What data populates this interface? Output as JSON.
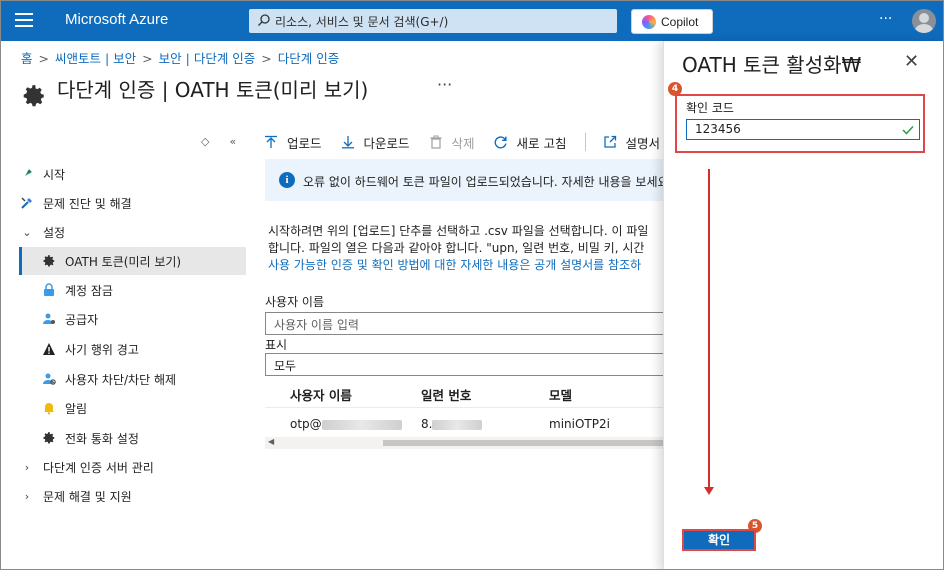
{
  "topbar": {
    "brand": "Microsoft Azure",
    "search_placeholder": "리소스, 서비스 및 문서 검색(G+/)",
    "copilot_label": "Copilot",
    "more": "···"
  },
  "breadcrumb": [
    "홈",
    "씨앤토트 | 보안",
    "보안 | 다단계 인증",
    "다단계 인증"
  ],
  "page": {
    "title": "다단계 인증 | OATH 토큰(미리 보기)",
    "more": "···"
  },
  "nav": {
    "tools": {
      "expand": "◇",
      "collapse": "«"
    },
    "items": [
      {
        "label": "시작",
        "icon": "rocket-icon"
      },
      {
        "label": "문제 진단 및 해결",
        "icon": "wrench-icon"
      },
      {
        "label": "설정",
        "icon": "chevron-down-icon"
      },
      {
        "label": "OATH 토큰(미리 보기)",
        "icon": "gear-icon"
      },
      {
        "label": "계정 잠금",
        "icon": "lock-icon"
      },
      {
        "label": "공급자",
        "icon": "user-settings-icon"
      },
      {
        "label": "사기 행위 경고",
        "icon": "warning-icon"
      },
      {
        "label": "사용자 차단/차단 해제",
        "icon": "user-block-icon"
      },
      {
        "label": "알림",
        "icon": "bell-icon"
      },
      {
        "label": "전화 통화 설정",
        "icon": "gear-icon"
      },
      {
        "label": "다단계 인증 서버 관리",
        "icon": "chevron-right-icon"
      },
      {
        "label": "문제 해결 및 지원",
        "icon": "chevron-right-icon"
      }
    ]
  },
  "toolbar": {
    "upload": "업로드",
    "download": "다운로드",
    "delete": "삭제",
    "refresh": "새로 고침",
    "docs": "설명서"
  },
  "info": {
    "text": "오류 없이 하드웨어 토큰 파일이 업로드되었습니다. 자세한 내용을 보세요"
  },
  "description": {
    "line1": "시작하려면 위의 [업로드] 단추를 선택하고 .csv 파일을 선택합니다. 이 파일",
    "line2": "합니다. 파일의 열은 다음과 같아야 합니다. \"upn, 일련 번호, 비밀 키, 시간",
    "link": "사용 가능한 인증 및 확인 방법에 대한 자세한 내용은 공개 설명서를 참조하"
  },
  "filters": {
    "username_label": "사용자 이름",
    "username_placeholder": "사용자 이름 입력",
    "show_label": "표시",
    "show_value": "모두"
  },
  "table": {
    "columns": [
      "사용자 이름",
      "일련 번호",
      "모델"
    ],
    "rows": [
      {
        "user": "otp@",
        "serial": "8.",
        "model": "miniOTP2i"
      }
    ]
  },
  "panel": {
    "title": "OATH 토큰 활성화₩",
    "code_label": "확인 코드",
    "code_value": "123456",
    "confirm": "확인",
    "badge_step1": "4",
    "badge_step2": "5"
  },
  "colors": {
    "accent": "#0f6cbd",
    "highlight": "#e04848",
    "badge": "#d9562c"
  }
}
